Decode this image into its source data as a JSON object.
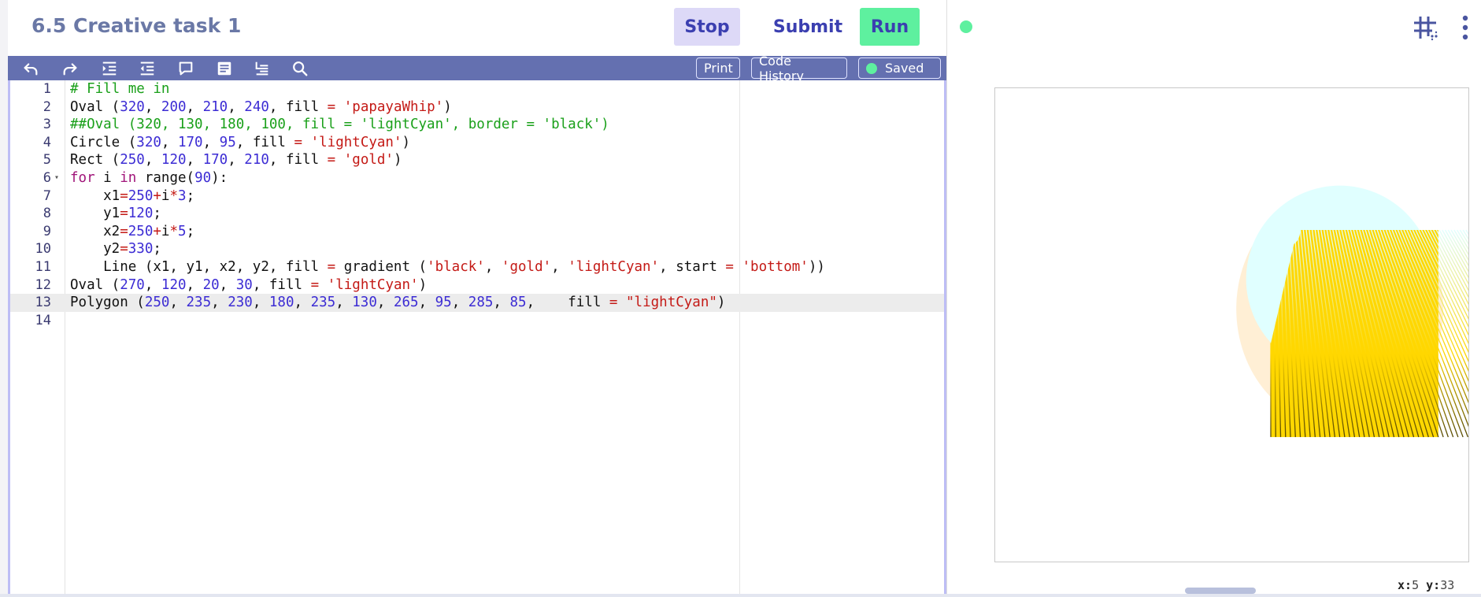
{
  "header": {
    "title": "6.5 Creative task 1",
    "stop_label": "Stop",
    "submit_label": "Submit",
    "run_label": "Run"
  },
  "toolbar": {
    "icons": [
      "undo-icon",
      "redo-icon",
      "indent-icon",
      "outdent-icon",
      "comment-icon",
      "block-comment-icon",
      "format-icon",
      "search-icon"
    ],
    "print_label": "Print",
    "code_history_label": "Code History",
    "saved_label": "Saved"
  },
  "editor": {
    "active_line": 13,
    "lines": [
      {
        "n": "1",
        "tokens": [
          [
            "c",
            "# Fill me in"
          ]
        ]
      },
      {
        "n": "2",
        "tokens": [
          [
            "p",
            "Oval ("
          ],
          [
            "n",
            "320"
          ],
          [
            "p",
            ", "
          ],
          [
            "n",
            "200"
          ],
          [
            "p",
            ", "
          ],
          [
            "n",
            "210"
          ],
          [
            "p",
            ", "
          ],
          [
            "n",
            "240"
          ],
          [
            "p",
            ", fill "
          ],
          [
            "o",
            "="
          ],
          [
            "p",
            " "
          ],
          [
            "s",
            "'papayaWhip'"
          ],
          [
            "p",
            ")"
          ]
        ]
      },
      {
        "n": "3",
        "tokens": [
          [
            "c",
            "##Oval (320, 130, 180, 100, fill = 'lightCyan', border = 'black')"
          ]
        ]
      },
      {
        "n": "4",
        "tokens": [
          [
            "p",
            "Circle ("
          ],
          [
            "n",
            "320"
          ],
          [
            "p",
            ", "
          ],
          [
            "n",
            "170"
          ],
          [
            "p",
            ", "
          ],
          [
            "n",
            "95"
          ],
          [
            "p",
            ", fill "
          ],
          [
            "o",
            "="
          ],
          [
            "p",
            " "
          ],
          [
            "s",
            "'lightCyan'"
          ],
          [
            "p",
            ")"
          ]
        ]
      },
      {
        "n": "5",
        "tokens": [
          [
            "p",
            "Rect ("
          ],
          [
            "n",
            "250"
          ],
          [
            "p",
            ", "
          ],
          [
            "n",
            "120"
          ],
          [
            "p",
            ", "
          ],
          [
            "n",
            "170"
          ],
          [
            "p",
            ", "
          ],
          [
            "n",
            "210"
          ],
          [
            "p",
            ", fill "
          ],
          [
            "o",
            "="
          ],
          [
            "p",
            " "
          ],
          [
            "s",
            "'gold'"
          ],
          [
            "p",
            ")"
          ]
        ]
      },
      {
        "n": "6",
        "fold": true,
        "tokens": [
          [
            "k",
            "for"
          ],
          [
            "p",
            " i "
          ],
          [
            "k",
            "in"
          ],
          [
            "p",
            " "
          ],
          [
            "p",
            "range("
          ],
          [
            "n",
            "90"
          ],
          [
            "p",
            "):"
          ]
        ]
      },
      {
        "n": "7",
        "tokens": [
          [
            "p",
            "    x1"
          ],
          [
            "o",
            "="
          ],
          [
            "n",
            "250"
          ],
          [
            "o",
            "+"
          ],
          [
            "p",
            "i"
          ],
          [
            "o",
            "*"
          ],
          [
            "n",
            "3"
          ],
          [
            "p",
            ";"
          ]
        ]
      },
      {
        "n": "8",
        "tokens": [
          [
            "p",
            "    y1"
          ],
          [
            "o",
            "="
          ],
          [
            "n",
            "120"
          ],
          [
            "p",
            ";"
          ]
        ]
      },
      {
        "n": "9",
        "tokens": [
          [
            "p",
            "    x2"
          ],
          [
            "o",
            "="
          ],
          [
            "n",
            "250"
          ],
          [
            "o",
            "+"
          ],
          [
            "p",
            "i"
          ],
          [
            "o",
            "*"
          ],
          [
            "n",
            "5"
          ],
          [
            "p",
            ";"
          ]
        ]
      },
      {
        "n": "10",
        "tokens": [
          [
            "p",
            "    y2"
          ],
          [
            "o",
            "="
          ],
          [
            "n",
            "330"
          ],
          [
            "p",
            ";"
          ]
        ]
      },
      {
        "n": "11",
        "tokens": [
          [
            "p",
            "    Line (x1, y1, x2, y2, fill "
          ],
          [
            "o",
            "="
          ],
          [
            "p",
            " gradient ("
          ],
          [
            "s",
            "'black'"
          ],
          [
            "p",
            ", "
          ],
          [
            "s",
            "'gold'"
          ],
          [
            "p",
            ", "
          ],
          [
            "s",
            "'lightCyan'"
          ],
          [
            "p",
            ", start "
          ],
          [
            "o",
            "="
          ],
          [
            "p",
            " "
          ],
          [
            "s",
            "'bottom'"
          ],
          [
            "p",
            "))"
          ]
        ]
      },
      {
        "n": "12",
        "tokens": [
          [
            "p",
            "Oval ("
          ],
          [
            "n",
            "270"
          ],
          [
            "p",
            ", "
          ],
          [
            "n",
            "120"
          ],
          [
            "p",
            ", "
          ],
          [
            "n",
            "20"
          ],
          [
            "p",
            ", "
          ],
          [
            "n",
            "30"
          ],
          [
            "p",
            ", fill "
          ],
          [
            "o",
            "="
          ],
          [
            "p",
            " "
          ],
          [
            "s",
            "'lightCyan'"
          ],
          [
            "p",
            ")"
          ]
        ]
      },
      {
        "n": "13",
        "tokens": [
          [
            "p",
            "Polygon ("
          ],
          [
            "n",
            "250"
          ],
          [
            "p",
            ", "
          ],
          [
            "n",
            "235"
          ],
          [
            "p",
            ", "
          ],
          [
            "n",
            "230"
          ],
          [
            "p",
            ", "
          ],
          [
            "n",
            "180"
          ],
          [
            "p",
            ", "
          ],
          [
            "n",
            "235"
          ],
          [
            "p",
            ", "
          ],
          [
            "n",
            "130"
          ],
          [
            "p",
            ", "
          ],
          [
            "n",
            "265"
          ],
          [
            "p",
            ", "
          ],
          [
            "n",
            "95"
          ],
          [
            "p",
            ", "
          ],
          [
            "n",
            "285"
          ],
          [
            "p",
            ", "
          ],
          [
            "n",
            "85"
          ],
          [
            "p",
            ",    fill "
          ],
          [
            "o",
            "="
          ],
          [
            "p",
            " "
          ],
          [
            "s",
            "\"lightCyan\""
          ],
          [
            "p",
            ")"
          ]
        ]
      },
      {
        "n": "14",
        "tokens": []
      }
    ]
  },
  "output": {
    "coords_x_label": "x:",
    "coords_x": "5",
    "coords_y_label": "y:",
    "coords_y": "33",
    "colors": {
      "papayaWhip": "#ffefd5",
      "lightCyan": "#e0ffff",
      "gold": "#ffd700",
      "black": "#000000"
    }
  },
  "theme": {
    "accent": "#6470b0",
    "run_green": "#5ef09f",
    "stop_bg": "#ddd9f7",
    "title_color": "#6a78a6"
  }
}
